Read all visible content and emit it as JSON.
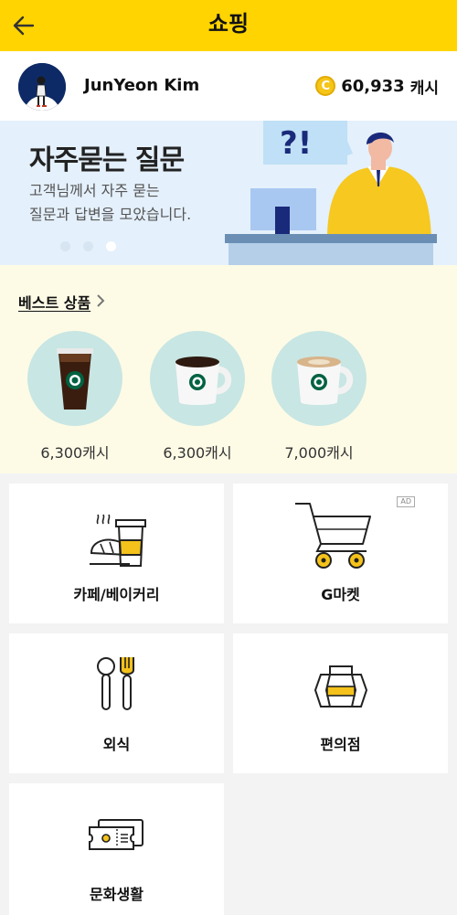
{
  "header": {
    "title": "쇼핑",
    "back_icon": "arrow-left-icon"
  },
  "profile": {
    "name": "JunYeon Kim",
    "cash_amount": "60,933",
    "cash_unit": "캐시",
    "coin_symbol": "C"
  },
  "banner": {
    "title": "자주묻는 질문",
    "subtitle": "고객님께서 자주 묻는\n질문과 답변을 모았습니다.",
    "bubble_text": "?!",
    "active_dot": 3
  },
  "best": {
    "title": "베스트 상품",
    "items": [
      {
        "price": "6,300캐시",
        "icon": "iced-coffee-icon"
      },
      {
        "price": "6,300캐시",
        "icon": "americano-mug-icon"
      },
      {
        "price": "7,000캐시",
        "icon": "latte-mug-icon"
      }
    ]
  },
  "categories": [
    {
      "label": "카페/베이커리",
      "icon": "cafe-bakery-icon"
    },
    {
      "label": "G마켓",
      "icon": "shopping-cart-icon",
      "badge": "AD"
    },
    {
      "label": "외식",
      "icon": "fork-spoon-icon"
    },
    {
      "label": "편의점",
      "icon": "convenience-store-icon"
    },
    {
      "label": "문화생활",
      "icon": "ticket-icon"
    }
  ],
  "colors": {
    "brand": "#ffd400",
    "accent": "#f4c21a",
    "banner_bg": "#e4f0fb",
    "best_bg": "#fdfbe6"
  }
}
